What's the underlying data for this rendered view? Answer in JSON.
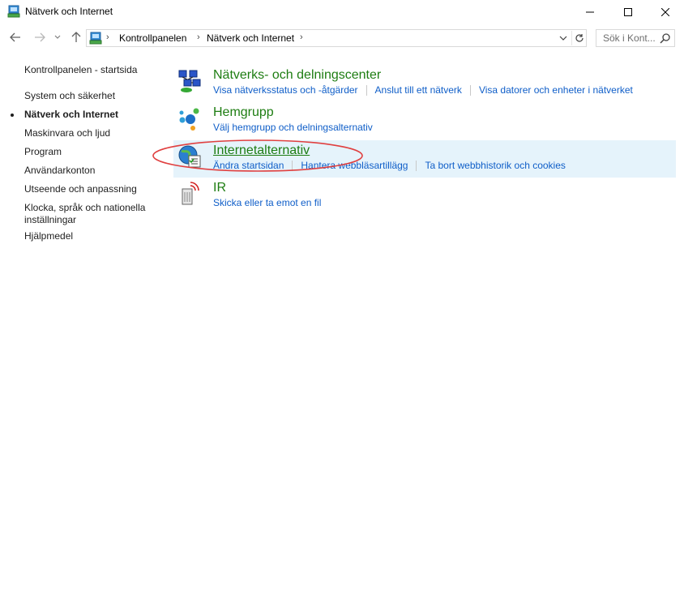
{
  "window": {
    "title": "Nätverk och Internet",
    "controls": [
      "minimize-icon",
      "maximize-icon",
      "close-icon"
    ]
  },
  "address": {
    "breadcrumbs": [
      "Kontrollpanelen",
      "Nätverk och Internet"
    ],
    "search_placeholder": "Sök i Kont..."
  },
  "sidebar": {
    "home": "Kontrollpanelen - startsida",
    "items": [
      {
        "label": "System och säkerhet",
        "active": false
      },
      {
        "label": "Nätverk och Internet",
        "active": true
      },
      {
        "label": "Maskinvara och ljud",
        "active": false
      },
      {
        "label": "Program",
        "active": false
      },
      {
        "label": "Användarkonton",
        "active": false
      },
      {
        "label": "Utseende och anpassning",
        "active": false
      },
      {
        "label": "Klocka, språk och nationella inställningar",
        "active": false
      },
      {
        "label": "Hjälpmedel",
        "active": false
      }
    ]
  },
  "categories": [
    {
      "title": "Nätverks- och delningscenter",
      "icon": "network-center-icon",
      "links": [
        "Visa nätverksstatus och -åtgärder",
        "Anslut till ett nätverk",
        "Visa datorer och enheter i nätverket"
      ]
    },
    {
      "title": "Hemgrupp",
      "icon": "homegroup-icon",
      "links": [
        "Välj hemgrupp och delningsalternativ"
      ]
    },
    {
      "title": "Internetalternativ",
      "icon": "internet-options-icon",
      "links": [
        "Ändra startsidan",
        "Hantera webbläsartillägg",
        "Ta bort webbhistorik och cookies"
      ]
    },
    {
      "title": "IR",
      "icon": "infrared-icon",
      "links": [
        "Skicka eller ta emot en fil"
      ]
    }
  ],
  "colors": {
    "category_title": "#1e7d12",
    "link": "#0f5ec8",
    "highlight": "#e5f3fb",
    "annotation": "#e04040"
  }
}
